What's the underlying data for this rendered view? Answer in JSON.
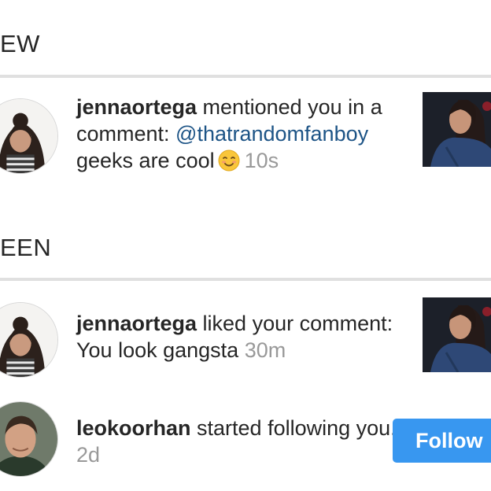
{
  "sections": {
    "new_title": "EW",
    "seen_title": "EEN"
  },
  "notifications": [
    {
      "username": "jennaortega",
      "action": " mentioned you in a comment: ",
      "mention": "@thatrandomfanboy",
      "comment": " geeks are cool",
      "emoji_icon": "smiling-face-icon",
      "time": "10s"
    },
    {
      "username": "jennaortega",
      "action": " liked your comment: You look gangsta ",
      "time": "30m"
    },
    {
      "username": "leokoorhan",
      "action": " started following you. ",
      "time": "2d",
      "follow_label": "Follow"
    }
  ],
  "colors": {
    "accent": "#3897f0",
    "mention": "#1d5486",
    "timestamp": "#999999",
    "divider": "#e0e0e0"
  }
}
